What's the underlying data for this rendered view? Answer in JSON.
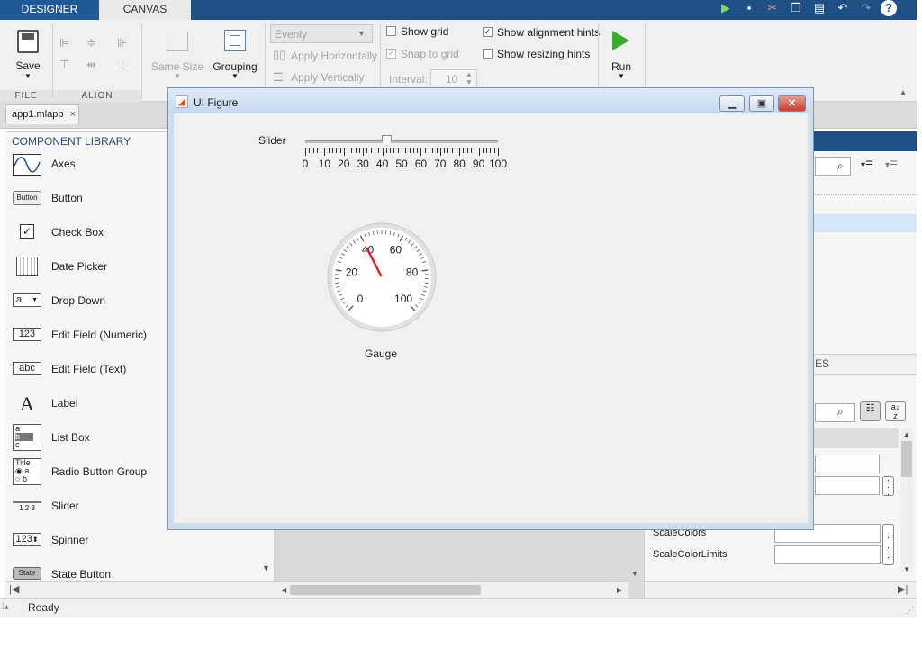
{
  "tabs": {
    "designer": "DESIGNER",
    "canvas": "CANVAS"
  },
  "quick_access": [
    "run-icon",
    "save-icon",
    "cut-icon",
    "copy-icon",
    "paste-icon",
    "undo-icon",
    "redo-icon",
    "help-icon"
  ],
  "ribbon": {
    "file": {
      "save": "Save",
      "section": "FILE"
    },
    "align": {
      "section": "ALIGN",
      "same_size": "Same Size",
      "grouping": "Grouping"
    },
    "space": {
      "dropdown": "Evenly",
      "apply_h": "Apply Horizontally",
      "apply_v": "Apply Vertically"
    },
    "grid": {
      "show_grid": "Show grid",
      "show_grid_checked": false,
      "snap": "Snap to grid",
      "snap_checked": true,
      "interval_label": "Interval:",
      "interval_value": "10"
    },
    "hints": {
      "align": "Show alignment hints",
      "align_checked": true,
      "resize": "Show resizing hints",
      "resize_checked": false
    },
    "run": {
      "label": "Run"
    }
  },
  "document_tab": {
    "label": "app1.mlapp",
    "close": "×"
  },
  "library": {
    "title": "COMPONENT LIBRARY",
    "items": [
      {
        "label": "Axes",
        "icon": "axes-icon"
      },
      {
        "label": "Button",
        "icon": "button-icon",
        "icon_text": "Button"
      },
      {
        "label": "Check Box",
        "icon": "checkbox-icon",
        "icon_text": "✓"
      },
      {
        "label": "Date Picker",
        "icon": "calendar-icon"
      },
      {
        "label": "Drop Down",
        "icon": "dropdown-icon",
        "icon_text": "a"
      },
      {
        "label": "Edit Field (Numeric)",
        "icon": "numeric-field-icon",
        "icon_text": "123"
      },
      {
        "label": "Edit Field (Text)",
        "icon": "text-field-icon",
        "icon_text": "abc"
      },
      {
        "label": "Label",
        "icon": "label-icon",
        "icon_text": "A"
      },
      {
        "label": "List Box",
        "icon": "listbox-icon",
        "icon_lines": [
          "a",
          "b",
          "c"
        ]
      },
      {
        "label": "Radio Button Group",
        "icon": "radio-group-icon",
        "icon_lines": [
          "Title",
          "a",
          "b"
        ]
      },
      {
        "label": "Slider",
        "icon": "slider-icon",
        "icon_text": "1 2 3"
      },
      {
        "label": "Spinner",
        "icon": "spinner-icon",
        "icon_text": "123"
      },
      {
        "label": "State Button",
        "icon": "state-button-icon",
        "icon_text": "State"
      }
    ]
  },
  "inspector": {
    "tab_partial": "ES",
    "rows": [
      {
        "label": "ScaleColors"
      },
      {
        "label": "ScaleColorLimits"
      }
    ]
  },
  "figure": {
    "title": "UI Figure",
    "slider": {
      "label": "Slider",
      "value": 42,
      "min": 0,
      "max": 100,
      "ticks": [
        "0",
        "10",
        "20",
        "30",
        "40",
        "50",
        "60",
        "70",
        "80",
        "90",
        "100"
      ]
    },
    "gauge": {
      "label": "Gauge",
      "value": 40,
      "min": 0,
      "max": 100,
      "ticks": [
        "0",
        "20",
        "40",
        "60",
        "80",
        "100"
      ]
    }
  },
  "status": {
    "text": "Ready"
  },
  "colors": {
    "accent": "#1f4f85",
    "needle": "#d22a2a"
  }
}
